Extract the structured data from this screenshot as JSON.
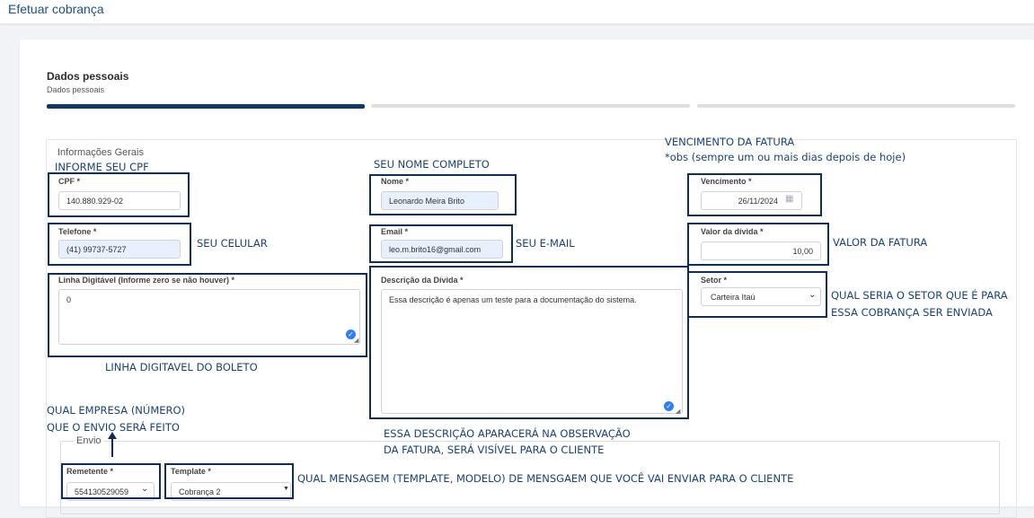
{
  "header": {
    "title": "Efetuar cobrança"
  },
  "stepper": {
    "title": "Dados pessoais",
    "subtitle": "Dados pessoais",
    "active_step": 1,
    "total_steps": 3
  },
  "section": {
    "legend": "Informações Gerais"
  },
  "fields": {
    "cpf": {
      "label": "CPF *",
      "value": "140.880.929-02"
    },
    "nome": {
      "label": "Nome *",
      "value": "Leonardo Meira Brito"
    },
    "vencimento": {
      "label": "Vencimento *",
      "value": "26/11/2024"
    },
    "telefone": {
      "label": "Telefone *",
      "value": "(41) 99737-5727"
    },
    "email": {
      "label": "Email *",
      "value": "leo.m.brito16@gmail.com"
    },
    "valor": {
      "label": "Valor da dívida *",
      "value": "10,00"
    },
    "linha": {
      "label": "Linha Digitável (Informe zero se não houver) *",
      "value": "0"
    },
    "descricao": {
      "label": "Descrição da Dívida *",
      "value": "Essa descrição é apenas um teste para a documentação do sistema."
    },
    "setor": {
      "label": "Setor *",
      "value": "Carteira Itaú"
    }
  },
  "envio": {
    "legend": "Envio",
    "remetente": {
      "label": "Remetente *",
      "value": "554130529059"
    },
    "template": {
      "label": "Template *",
      "value": "Cobrança 2"
    }
  },
  "annotations": {
    "cpf": "INFORME SEU CPF",
    "nome": "SEU NOME COMPLETO",
    "vencimento_1": "VENCIMENTO DA FATURA",
    "vencimento_2": "*obs (sempre um ou mais dias depois de hoje)",
    "celular": "SEU CELULAR",
    "email": "SEU E-MAIL",
    "valor": "VALOR DA FATURA",
    "setor_1": "QUAL SERIA O SETOR QUE É PARA",
    "setor_2": "ESSA COBRANÇA SER ENVIADA",
    "linha": "LINHA DIGITAVEL DO BOLETO",
    "empresa_1": "QUAL EMPRESA (NÚMERO)",
    "empresa_2": "QUE O ENVIO SERÁ FEITO",
    "descricao_1": "ESSA DESCRIÇÃO APARACERÁ NA OBSERVAÇÃO",
    "descricao_2": "DA FATURA, SERÁ VISÍVEL PARA O CLIENTE",
    "template": "QUAL MENSAGEM (TEMPLATE, MODELO) DE MENSGAEM QUE VOCÊ VAI ENVIAR PARA O CLIENTE"
  },
  "colors": {
    "accent": "#0d3b66",
    "annotation": "#17427a",
    "autofill": "#e8f0fe"
  },
  "icons": {
    "calendar": "calendar-icon",
    "chevron": "chevron-down-icon",
    "grammar": "check-circle-icon"
  }
}
